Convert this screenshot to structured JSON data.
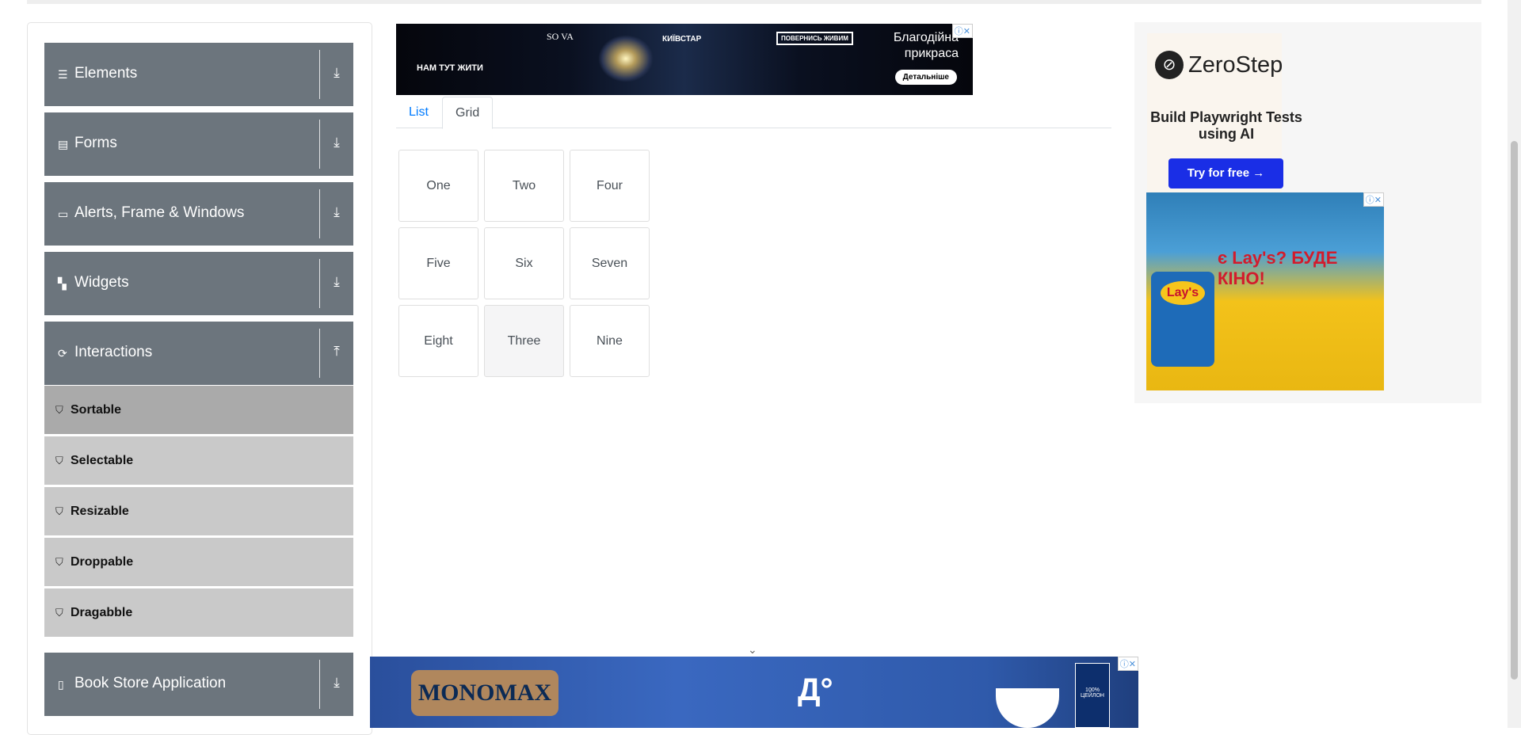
{
  "sidebar": {
    "groups": [
      {
        "label": "Elements",
        "icon": "bars-icon",
        "arrow": "download-arrow-icon"
      },
      {
        "label": "Forms",
        "icon": "file-icon",
        "arrow": "download-arrow-icon"
      },
      {
        "label": "Alerts, Frame & Windows",
        "icon": "window-icon",
        "arrow": "download-arrow-icon"
      },
      {
        "label": "Widgets",
        "icon": "widgets-icon",
        "arrow": "download-arrow-icon"
      },
      {
        "label": "Interactions",
        "icon": "sync-icon",
        "arrow": "upload-arrow-icon"
      },
      {
        "label": "Book Store Application",
        "icon": "book-icon",
        "arrow": "download-arrow-icon"
      }
    ],
    "interactions": [
      "Sortable",
      "Selectable",
      "Resizable",
      "Droppable",
      "Dragabble"
    ],
    "active_item": "Sortable"
  },
  "top_ad": {
    "left_text": "НАМ ТУТ ЖИТИ",
    "sova": "SO VA",
    "kyivstar": "КИЇВСТАР",
    "tag": "ПОВЕРНИСЬ ЖИВИМ",
    "headline_line1": "Благодійна",
    "headline_line2": "прикраса",
    "button": "Детальніше"
  },
  "tabs": {
    "list": "List",
    "grid": "Grid",
    "active": "Grid"
  },
  "grid_items": [
    "One",
    "Two",
    "Four",
    "Five",
    "Six",
    "Seven",
    "Eight",
    "Three",
    "Nine"
  ],
  "right_ad": {
    "brand": "ZeroStep",
    "tagline": "Build Playwright Tests using AI",
    "button": "Try for free →",
    "lays_text": "є Lay's? БУДЕ КІНО!",
    "lays_pack": "Lay's"
  },
  "bottom_ad": {
    "brand": "MONOMAX",
    "box": "100% ЦЕЙЛОН"
  }
}
